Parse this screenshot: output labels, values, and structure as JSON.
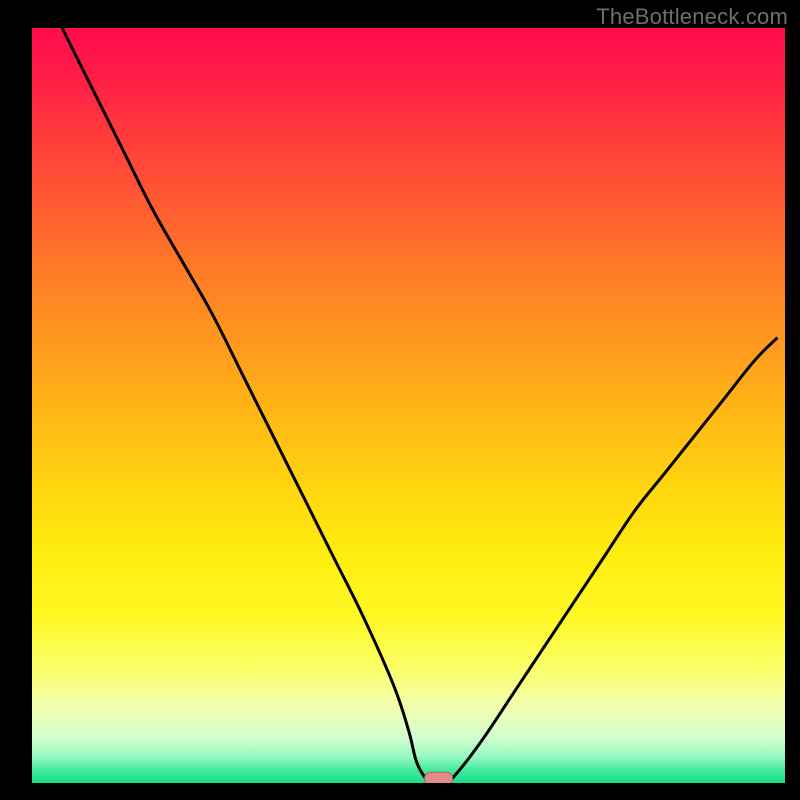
{
  "watermark": "TheBottleneck.com",
  "colors": {
    "line": "#000000",
    "marker_fill": "#e28b8b",
    "marker_stroke": "#b85f5f",
    "gradient_stops": [
      {
        "offset": 0.0,
        "color": "#ff0d4d"
      },
      {
        "offset": 0.06,
        "color": "#ff1b47"
      },
      {
        "offset": 0.14,
        "color": "#ff3a3b"
      },
      {
        "offset": 0.23,
        "color": "#ff5a31"
      },
      {
        "offset": 0.32,
        "color": "#ff7a28"
      },
      {
        "offset": 0.42,
        "color": "#ff9a1e"
      },
      {
        "offset": 0.52,
        "color": "#ffba15"
      },
      {
        "offset": 0.62,
        "color": "#ffd90e"
      },
      {
        "offset": 0.7,
        "color": "#ffed10"
      },
      {
        "offset": 0.78,
        "color": "#fff824"
      },
      {
        "offset": 0.85,
        "color": "#fbff6a"
      },
      {
        "offset": 0.9,
        "color": "#f0ffb0"
      },
      {
        "offset": 0.94,
        "color": "#d2ffcf"
      },
      {
        "offset": 0.965,
        "color": "#97f7c2"
      },
      {
        "offset": 0.985,
        "color": "#3de89b"
      },
      {
        "offset": 1.0,
        "color": "#18df85"
      }
    ]
  },
  "chart_data": {
    "type": "line",
    "title": "",
    "xlabel": "",
    "ylabel": "",
    "xlim": [
      0,
      100
    ],
    "ylim": [
      0,
      100
    ],
    "series": [
      {
        "name": "bottleneck-curve",
        "x": [
          4,
          8,
          12,
          16,
          20,
          24,
          28,
          32,
          36,
          40,
          44,
          48,
          50,
          51,
          52,
          53,
          55,
          57,
          60,
          64,
          68,
          72,
          76,
          80,
          84,
          88,
          92,
          96,
          99
        ],
        "y": [
          100,
          92,
          84,
          76,
          69,
          62,
          54,
          46,
          38,
          30,
          22,
          13,
          7,
          3,
          1,
          0,
          0,
          2,
          6,
          12,
          18,
          24,
          30,
          36,
          41,
          46,
          51,
          56,
          59
        ]
      }
    ],
    "marker_center": {
      "x": 54,
      "y": 0.5
    }
  }
}
